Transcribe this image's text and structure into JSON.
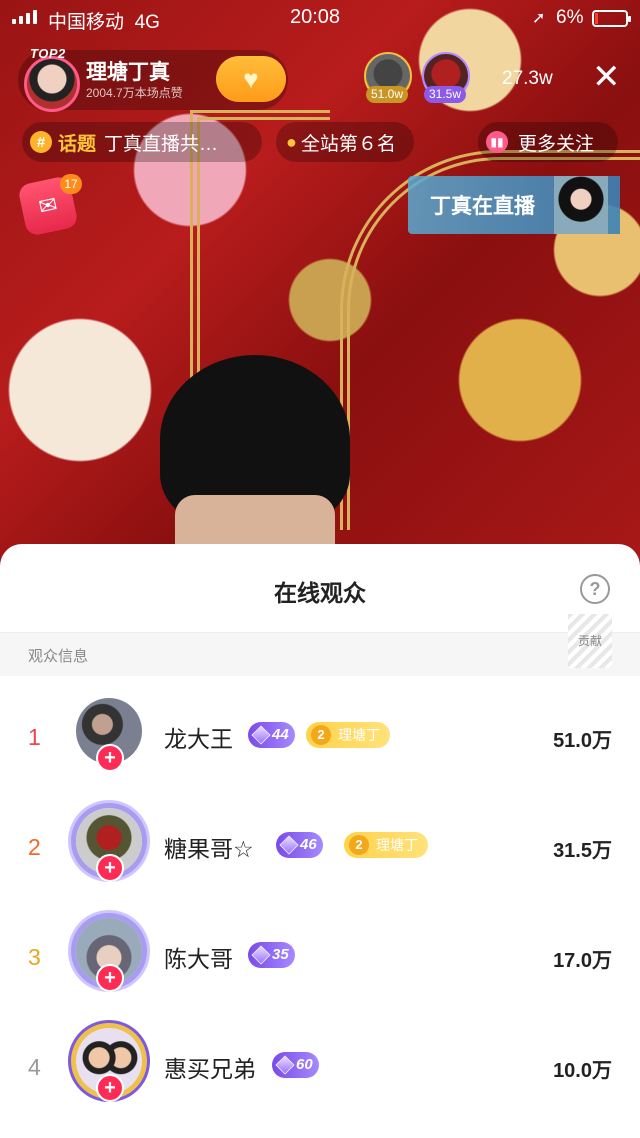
{
  "status_bar": {
    "carrier": "中国移动",
    "network": "4G",
    "time": "20:08",
    "battery": "6%"
  },
  "host": {
    "rank_badge": "TOP2",
    "name": "理塘丁真",
    "likes": "2004.7万本场点赞",
    "follow_icon": "+"
  },
  "top_viewers": [
    {
      "amount": "51.0w"
    },
    {
      "amount": "31.5w"
    }
  ],
  "viewer_count": "27.3w",
  "close_icon": "✕",
  "topic_chip": {
    "tag": "话题",
    "text": "丁真直播共…"
  },
  "rank_chip": "全站第６名",
  "more_chip": "更多关注",
  "red_packet": {
    "count": "17"
  },
  "promo": {
    "text": "丁真在直播"
  },
  "sheet": {
    "title": "在线观众",
    "help": "?",
    "column_left": "观众信息",
    "column_right": "贡献"
  },
  "audience": [
    {
      "rank": "1",
      "name": "龙大王",
      "level": "44",
      "fan_level": "2",
      "fan_name": "理塘丁",
      "score": "51.0万"
    },
    {
      "rank": "2",
      "name": "糖果哥☆",
      "level": "46",
      "fan_level": "2",
      "fan_name": "理塘丁",
      "score": "31.5万"
    },
    {
      "rank": "3",
      "name": "陈大哥",
      "level": "35",
      "score": "17.0万"
    },
    {
      "rank": "4",
      "name": "惠买兄弟",
      "level": "60",
      "score": "10.0万"
    }
  ],
  "colors": {
    "accent_red": "#fe2c55",
    "level_purple": "#7a4ae8",
    "fan_gold": "#ffd24a"
  }
}
